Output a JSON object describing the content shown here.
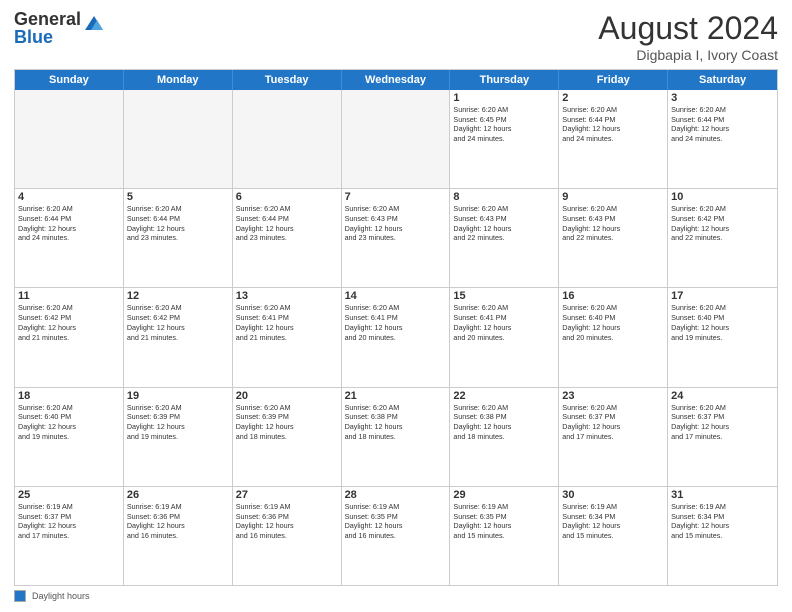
{
  "header": {
    "logo_general": "General",
    "logo_blue": "Blue",
    "month_year": "August 2024",
    "location": "Digbapia I, Ivory Coast"
  },
  "days_of_week": [
    "Sunday",
    "Monday",
    "Tuesday",
    "Wednesday",
    "Thursday",
    "Friday",
    "Saturday"
  ],
  "weeks": [
    [
      {
        "day": "",
        "info": ""
      },
      {
        "day": "",
        "info": ""
      },
      {
        "day": "",
        "info": ""
      },
      {
        "day": "",
        "info": ""
      },
      {
        "day": "1",
        "info": "Sunrise: 6:20 AM\nSunset: 6:45 PM\nDaylight: 12 hours\nand 24 minutes."
      },
      {
        "day": "2",
        "info": "Sunrise: 6:20 AM\nSunset: 6:44 PM\nDaylight: 12 hours\nand 24 minutes."
      },
      {
        "day": "3",
        "info": "Sunrise: 6:20 AM\nSunset: 6:44 PM\nDaylight: 12 hours\nand 24 minutes."
      }
    ],
    [
      {
        "day": "4",
        "info": "Sunrise: 6:20 AM\nSunset: 6:44 PM\nDaylight: 12 hours\nand 24 minutes."
      },
      {
        "day": "5",
        "info": "Sunrise: 6:20 AM\nSunset: 6:44 PM\nDaylight: 12 hours\nand 23 minutes."
      },
      {
        "day": "6",
        "info": "Sunrise: 6:20 AM\nSunset: 6:44 PM\nDaylight: 12 hours\nand 23 minutes."
      },
      {
        "day": "7",
        "info": "Sunrise: 6:20 AM\nSunset: 6:43 PM\nDaylight: 12 hours\nand 23 minutes."
      },
      {
        "day": "8",
        "info": "Sunrise: 6:20 AM\nSunset: 6:43 PM\nDaylight: 12 hours\nand 22 minutes."
      },
      {
        "day": "9",
        "info": "Sunrise: 6:20 AM\nSunset: 6:43 PM\nDaylight: 12 hours\nand 22 minutes."
      },
      {
        "day": "10",
        "info": "Sunrise: 6:20 AM\nSunset: 6:42 PM\nDaylight: 12 hours\nand 22 minutes."
      }
    ],
    [
      {
        "day": "11",
        "info": "Sunrise: 6:20 AM\nSunset: 6:42 PM\nDaylight: 12 hours\nand 21 minutes."
      },
      {
        "day": "12",
        "info": "Sunrise: 6:20 AM\nSunset: 6:42 PM\nDaylight: 12 hours\nand 21 minutes."
      },
      {
        "day": "13",
        "info": "Sunrise: 6:20 AM\nSunset: 6:41 PM\nDaylight: 12 hours\nand 21 minutes."
      },
      {
        "day": "14",
        "info": "Sunrise: 6:20 AM\nSunset: 6:41 PM\nDaylight: 12 hours\nand 20 minutes."
      },
      {
        "day": "15",
        "info": "Sunrise: 6:20 AM\nSunset: 6:41 PM\nDaylight: 12 hours\nand 20 minutes."
      },
      {
        "day": "16",
        "info": "Sunrise: 6:20 AM\nSunset: 6:40 PM\nDaylight: 12 hours\nand 20 minutes."
      },
      {
        "day": "17",
        "info": "Sunrise: 6:20 AM\nSunset: 6:40 PM\nDaylight: 12 hours\nand 19 minutes."
      }
    ],
    [
      {
        "day": "18",
        "info": "Sunrise: 6:20 AM\nSunset: 6:40 PM\nDaylight: 12 hours\nand 19 minutes."
      },
      {
        "day": "19",
        "info": "Sunrise: 6:20 AM\nSunset: 6:39 PM\nDaylight: 12 hours\nand 19 minutes."
      },
      {
        "day": "20",
        "info": "Sunrise: 6:20 AM\nSunset: 6:39 PM\nDaylight: 12 hours\nand 18 minutes."
      },
      {
        "day": "21",
        "info": "Sunrise: 6:20 AM\nSunset: 6:38 PM\nDaylight: 12 hours\nand 18 minutes."
      },
      {
        "day": "22",
        "info": "Sunrise: 6:20 AM\nSunset: 6:38 PM\nDaylight: 12 hours\nand 18 minutes."
      },
      {
        "day": "23",
        "info": "Sunrise: 6:20 AM\nSunset: 6:37 PM\nDaylight: 12 hours\nand 17 minutes."
      },
      {
        "day": "24",
        "info": "Sunrise: 6:20 AM\nSunset: 6:37 PM\nDaylight: 12 hours\nand 17 minutes."
      }
    ],
    [
      {
        "day": "25",
        "info": "Sunrise: 6:19 AM\nSunset: 6:37 PM\nDaylight: 12 hours\nand 17 minutes."
      },
      {
        "day": "26",
        "info": "Sunrise: 6:19 AM\nSunset: 6:36 PM\nDaylight: 12 hours\nand 16 minutes."
      },
      {
        "day": "27",
        "info": "Sunrise: 6:19 AM\nSunset: 6:36 PM\nDaylight: 12 hours\nand 16 minutes."
      },
      {
        "day": "28",
        "info": "Sunrise: 6:19 AM\nSunset: 6:35 PM\nDaylight: 12 hours\nand 16 minutes."
      },
      {
        "day": "29",
        "info": "Sunrise: 6:19 AM\nSunset: 6:35 PM\nDaylight: 12 hours\nand 15 minutes."
      },
      {
        "day": "30",
        "info": "Sunrise: 6:19 AM\nSunset: 6:34 PM\nDaylight: 12 hours\nand 15 minutes."
      },
      {
        "day": "31",
        "info": "Sunrise: 6:19 AM\nSunset: 6:34 PM\nDaylight: 12 hours\nand 15 minutes."
      }
    ]
  ],
  "legend": {
    "label": "Daylight hours"
  }
}
